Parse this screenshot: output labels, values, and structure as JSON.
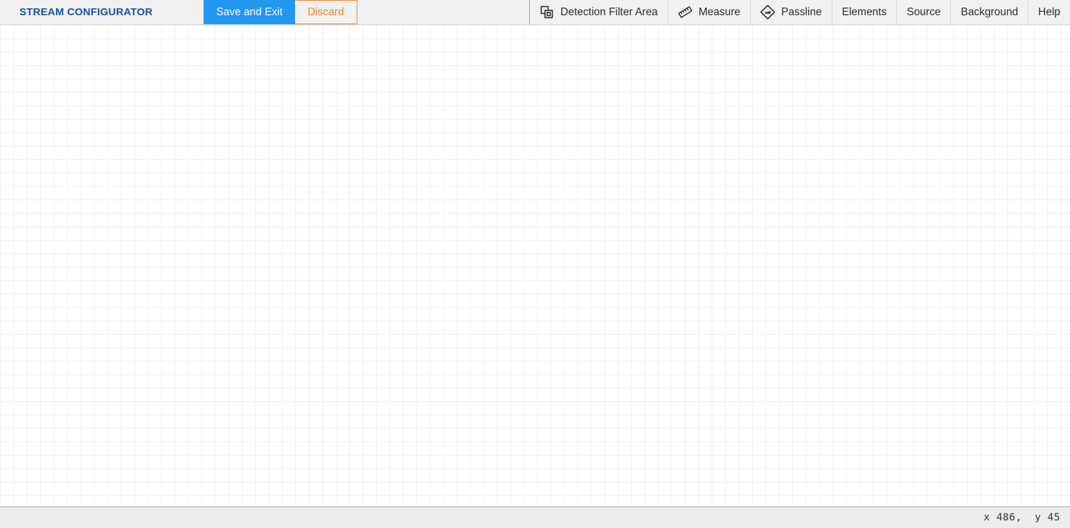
{
  "app": {
    "title": "STREAM CONFIGURATOR",
    "accent_blue": "#2196f3",
    "accent_orange": "#f08220",
    "title_color": "#14539e",
    "toolbar_bg": "#f1f1f1",
    "canvas_bg": "#ffffff",
    "grid_line_color": "#efefef",
    "statusbar_bg": "#ececec"
  },
  "toolbar": {
    "save_label": "Save and Exit",
    "discard_label": "Discard",
    "menu_items": [
      {
        "label": "Detection Filter Area",
        "icon": "detection-filter-area-icon",
        "has_icon": true
      },
      {
        "label": "Measure",
        "icon": "ruler-icon",
        "has_icon": true
      },
      {
        "label": "Passline",
        "icon": "passline-diamond-icon",
        "has_icon": true
      },
      {
        "label": "Elements",
        "icon": "",
        "has_icon": false
      },
      {
        "label": "Source",
        "icon": "",
        "has_icon": false
      },
      {
        "label": "Background",
        "icon": "",
        "has_icon": false
      },
      {
        "label": "Help",
        "icon": "",
        "has_icon": false
      }
    ]
  },
  "canvas": {
    "grid_spacing_px": "19.4",
    "elements": []
  },
  "statusbar": {
    "coordinates": "x 486,  y 45",
    "x_value": "486",
    "y_value": "45"
  }
}
